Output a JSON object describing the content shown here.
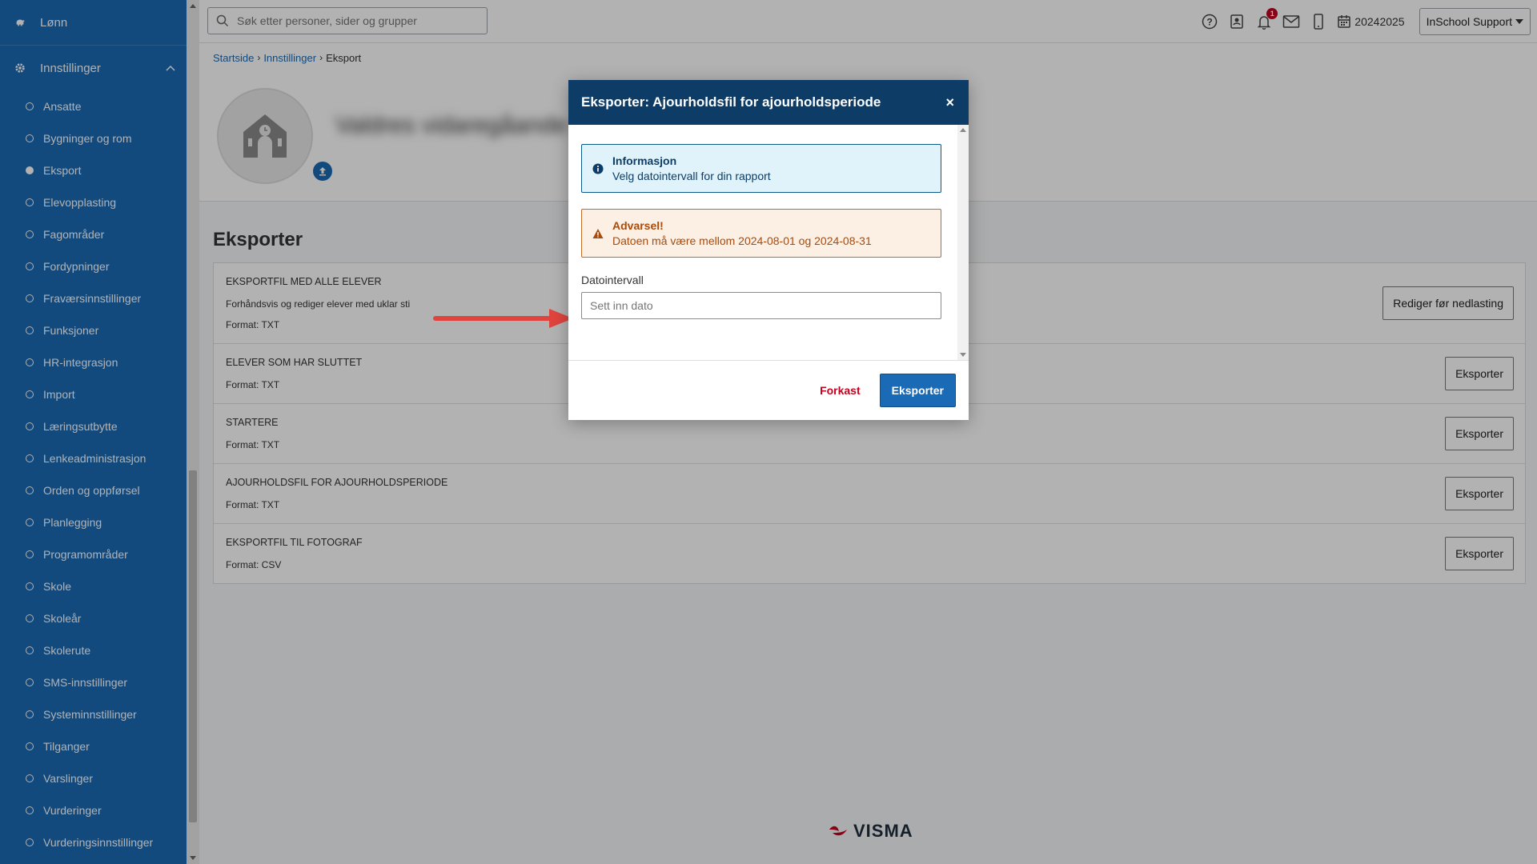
{
  "sidebar": {
    "top_item": "Lønn",
    "section": "Innstillinger",
    "items": [
      {
        "label": "Ansatte",
        "active": false
      },
      {
        "label": "Bygninger og rom",
        "active": false
      },
      {
        "label": "Eksport",
        "active": true
      },
      {
        "label": "Elevopplasting",
        "active": false
      },
      {
        "label": "Fagområder",
        "active": false
      },
      {
        "label": "Fordypninger",
        "active": false
      },
      {
        "label": "Fraværsinnstillinger",
        "active": false
      },
      {
        "label": "Funksjoner",
        "active": false
      },
      {
        "label": "HR-integrasjon",
        "active": false
      },
      {
        "label": "Import",
        "active": false
      },
      {
        "label": "Læringsutbytte",
        "active": false
      },
      {
        "label": "Lenkeadministrasjon",
        "active": false
      },
      {
        "label": "Orden og oppførsel",
        "active": false
      },
      {
        "label": "Planlegging",
        "active": false
      },
      {
        "label": "Programområder",
        "active": false
      },
      {
        "label": "Skole",
        "active": false
      },
      {
        "label": "Skoleår",
        "active": false
      },
      {
        "label": "Skolerute",
        "active": false
      },
      {
        "label": "SMS-innstillinger",
        "active": false
      },
      {
        "label": "Systeminnstillinger",
        "active": false
      },
      {
        "label": "Tilganger",
        "active": false
      },
      {
        "label": "Varslinger",
        "active": false
      },
      {
        "label": "Vurderinger",
        "active": false
      },
      {
        "label": "Vurderingsinnstillinger",
        "active": false
      }
    ]
  },
  "header": {
    "search_placeholder": "Søk etter personer, sider og grupper",
    "notification_count": "1",
    "school_year": "20242025",
    "user": "InSchool Support"
  },
  "breadcrumb": {
    "items": [
      "Startside",
      "Innstillinger"
    ],
    "current": "Eksport"
  },
  "banner": {
    "school_name": "Valdres vidaregåande skule"
  },
  "page": {
    "title": "Eksporter",
    "rows": [
      {
        "title": "EKSPORTFIL MED ALLE ELEVER",
        "description": "Forhåndsvis og rediger elever med uklar sti",
        "format": "Format: TXT",
        "button": "Rediger før nedlasting"
      },
      {
        "title": "ELEVER SOM HAR SLUTTET",
        "description": "",
        "format": "Format: TXT",
        "button": "Eksporter"
      },
      {
        "title": "STARTERE",
        "description": "",
        "format": "Format: TXT",
        "button": "Eksporter"
      },
      {
        "title": "AJOURHOLDSFIL FOR AJOURHOLDSPERIODE",
        "description": "",
        "format": "Format: TXT",
        "button": "Eksporter"
      },
      {
        "title": "EKSPORTFIL TIL FOTOGRAF",
        "description": "",
        "format": "Format: CSV",
        "button": "Eksporter"
      }
    ]
  },
  "footer": {
    "logo_text": "VISMA"
  },
  "modal": {
    "title": "Eksporter: Ajourholdsfil for ajourholdsperiode",
    "close": "×",
    "info_title": "Informasjon",
    "info_text": "Velg datointervall for din rapport",
    "warn_title": "Advarsel!",
    "warn_text": "Datoen må være mellom 2024-08-01 og 2024-08-31",
    "field_label": "Datointervall",
    "input_placeholder": "Sett inn dato",
    "discard_label": "Forkast",
    "export_label": "Eksporter"
  },
  "colors": {
    "sidebar_bg": "#1a6ab5",
    "modal_header": "#0d3c66",
    "primary": "#1a6ab5",
    "danger": "#c6001e",
    "arrow": "#e0443e"
  }
}
